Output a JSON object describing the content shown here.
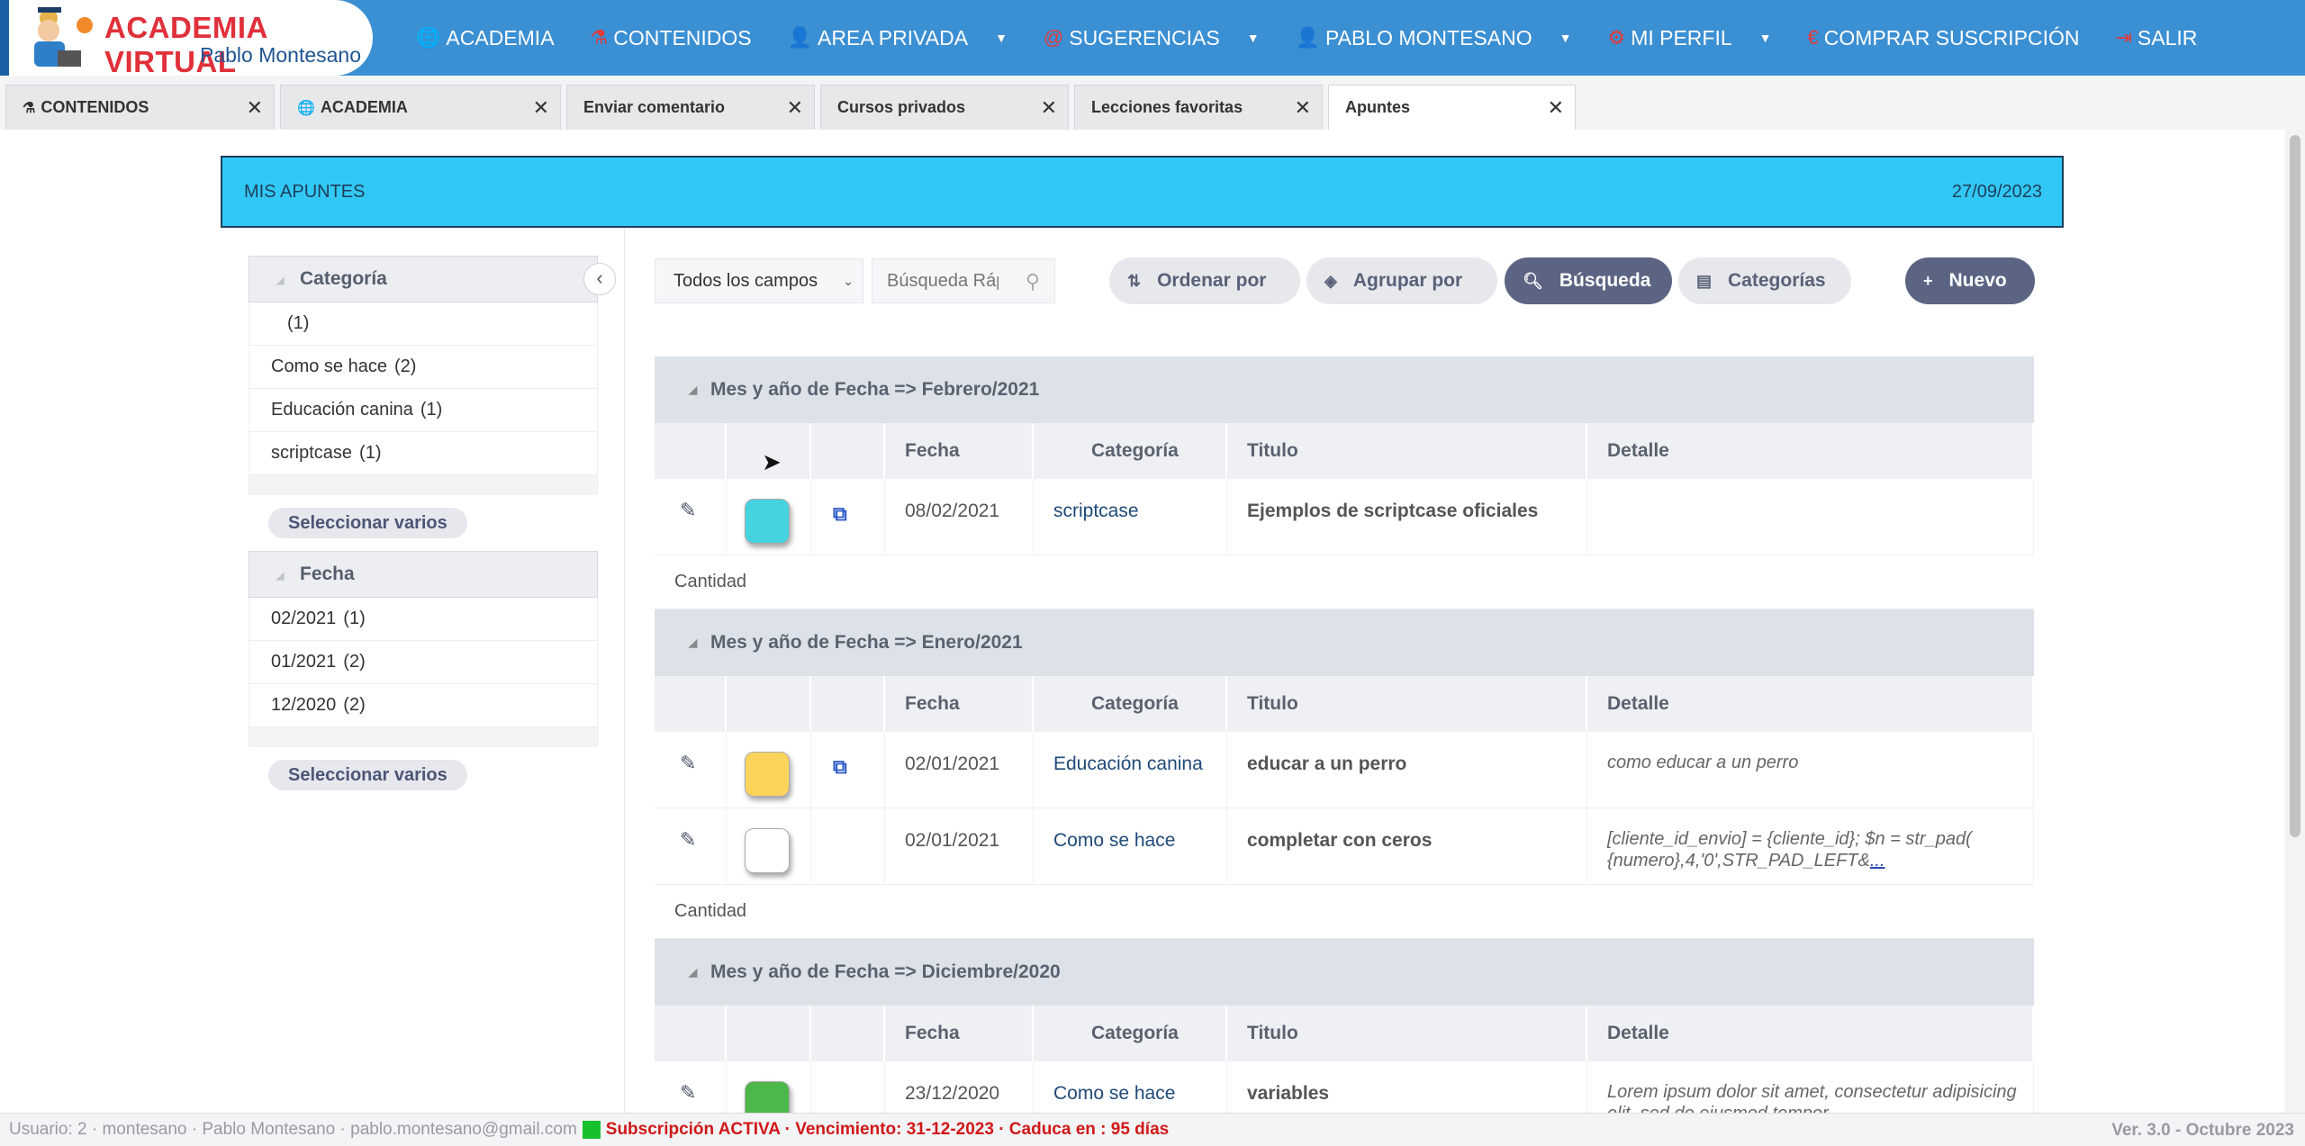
{
  "logo": {
    "title": "ACADEMIA VIRTUAL",
    "subtitle": "Pablo Montesano"
  },
  "nav": [
    {
      "icon": "globe-icon",
      "label": "ACADEMIA",
      "caret": false
    },
    {
      "icon": "flask-icon",
      "label": "CONTENIDOS",
      "caret": false
    },
    {
      "icon": "user-lock-icon",
      "label": "AREA PRIVADA",
      "caret": true
    },
    {
      "icon": "at-icon",
      "label": "SUGERENCIAS",
      "caret": true
    },
    {
      "icon": "user-icon",
      "label": "PABLO MONTESANO",
      "caret": true
    },
    {
      "icon": "gears-icon",
      "label": "MI PERFIL",
      "caret": true
    },
    {
      "icon": "euro-icon",
      "label": "COMPRAR SUSCRIPCIÓN",
      "caret": false
    },
    {
      "icon": "exit-icon",
      "label": "SALIR",
      "caret": false
    }
  ],
  "tabs": [
    {
      "label": "CONTENIDOS",
      "icon": "flask-icon",
      "active": false
    },
    {
      "label": "ACADEMIA",
      "icon": "globe-icon",
      "active": false
    },
    {
      "label": "Enviar comentario",
      "active": false
    },
    {
      "label": "Cursos privados",
      "active": false
    },
    {
      "label": "Lecciones favoritas",
      "active": false
    },
    {
      "label": "Apuntes",
      "active": true
    }
  ],
  "banner": {
    "title": "MIS APUNTES",
    "date": "27/09/2023"
  },
  "filters": {
    "categoria": {
      "title": "Categoría",
      "items": [
        {
          "label": "",
          "count": "(1)"
        },
        {
          "label": "Como se hace",
          "count": "(2)"
        },
        {
          "label": "Educación canina",
          "count": "(1)"
        },
        {
          "label": "scriptcase",
          "count": "(1)"
        }
      ],
      "button": "Seleccionar varios"
    },
    "fecha": {
      "title": "Fecha",
      "items": [
        {
          "label": "02/2021",
          "count": "(1)"
        },
        {
          "label": "01/2021",
          "count": "(2)"
        },
        {
          "label": "12/2020",
          "count": "(2)"
        }
      ],
      "button": "Seleccionar varios"
    }
  },
  "toolbar": {
    "field_select": "Todos los campos",
    "search_placeholder": "Búsqueda Rápida",
    "order_label": "Ordenar por",
    "group_label": "Agrupar por",
    "search_label": "Búsqueda",
    "categories_label": "Categorías",
    "new_label": "Nuevo"
  },
  "columns": [
    "Fecha",
    "Categoría",
    "Titulo",
    "Detalle"
  ],
  "qty_label": "Cantidad",
  "groups": [
    {
      "title": "Mes y año de Fecha => Febrero/2021",
      "rows": [
        {
          "color": "#45d3df",
          "link": true,
          "fecha": "08/02/2021",
          "categoria": "scriptcase",
          "titulo": "Ejemplos de scriptcase oficiales",
          "detalle": "",
          "more": ""
        }
      ]
    },
    {
      "title": "Mes y año de Fecha => Enero/2021",
      "rows": [
        {
          "color": "#fcd45c",
          "link": true,
          "fecha": "02/01/2021",
          "categoria": "Educación canina",
          "titulo": "educar a un perro",
          "detalle": "como educar a un perro",
          "more": ""
        },
        {
          "color": "#ffffff",
          "link": false,
          "fecha": "02/01/2021",
          "categoria": "Como se hace",
          "titulo": "completar con ceros",
          "detalle": "[cliente_id_envio] = {cliente_id};   $n = str_pad( {numero},4,'0',STR_PAD_LEFT&",
          "more": "..."
        }
      ]
    },
    {
      "title": "Mes y año de Fecha => Diciembre/2020",
      "rows": [
        {
          "color": "#4cb84a",
          "link": false,
          "fecha": "23/12/2020",
          "categoria": "Como se hace",
          "titulo": "variables",
          "detalle": "Lorem ipsum dolor sit amet, consectetur adipisicing elit, sed do eiusmod tempor",
          "more": ""
        }
      ]
    }
  ],
  "status": {
    "user": "Usuario: 2 · montesano · Pablo Montesano · pablo.montesano@gmail.com",
    "subscription": "Subscripción ACTIVA · Vencimiento: 31-12-2023 · Caduca en : 95 días",
    "version": "Ver. 3.0 - Octubre 2023"
  }
}
